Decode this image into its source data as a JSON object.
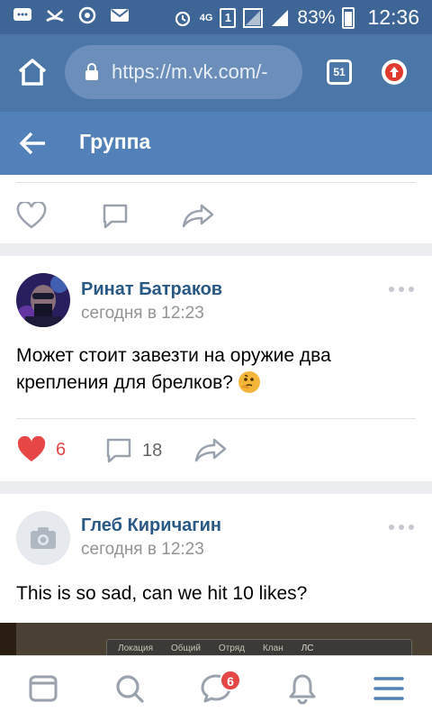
{
  "status_bar": {
    "network": "4G",
    "sim": "1",
    "battery": "83%",
    "time": "12:36"
  },
  "browser": {
    "url": "https://m.vk.com/-",
    "tab_count": "51"
  },
  "app_header": {
    "title": "Группа"
  },
  "prev_post": {
    "icons": [
      "heart-outline-icon",
      "comment-icon",
      "share-icon"
    ]
  },
  "posts": [
    {
      "author": "Ринат Батраков",
      "time": "сегодня в 12:23",
      "text": "Может стоит завезти на оружие два крепления для брелков?",
      "emoji": "thinking-face-emoji",
      "likes": "6",
      "comments": "18",
      "liked": true
    },
    {
      "author": "Глеб Киричагин",
      "time": "сегодня в 12:23",
      "text": "This is so sad, can we hit 10 likes?"
    }
  ],
  "image_strip": {
    "labels": [
      "Локация",
      "Общий",
      "Отряд",
      "Клан",
      "ЛС"
    ]
  },
  "bottom_nav": {
    "items": [
      "feed-icon",
      "search-icon",
      "messages-icon",
      "notifications-icon",
      "menu-icon"
    ],
    "messages_badge": "6"
  },
  "colors": {
    "header": "#5181b8",
    "browser": "#4a76a8",
    "status": "#3d6595",
    "like": "#e64646",
    "link": "#2a5885"
  }
}
